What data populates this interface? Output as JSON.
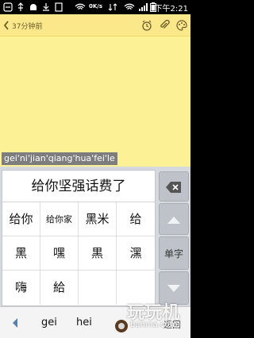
{
  "status_bar": {
    "network_speed": "0K/s",
    "time": "下午2:21"
  },
  "note_header": {
    "back_label": "37分钟前",
    "icons": [
      "alarm-icon",
      "attachment-icon",
      "palette-icon"
    ]
  },
  "composing": {
    "pinyin": "gei'ni'jian'qiang'hua'fei'le"
  },
  "keyboard": {
    "top_candidate": "给你坚强话费了",
    "candidates": [
      [
        "给你",
        "给你家",
        "黑米",
        "给"
      ],
      [
        "黑",
        "嘿",
        "黒",
        "潶"
      ],
      [
        "嗨",
        "給",
        "",
        ""
      ]
    ],
    "side_keys": {
      "delete": "delete-icon",
      "up": "up-arrow-icon",
      "mode_label": "单字",
      "down": "down-arrow-icon"
    },
    "pinyin_options": [
      "gei",
      "hei"
    ],
    "return_label": "返回"
  },
  "watermark": {
    "main": "玩玩机",
    "sub": "banma.com"
  }
}
